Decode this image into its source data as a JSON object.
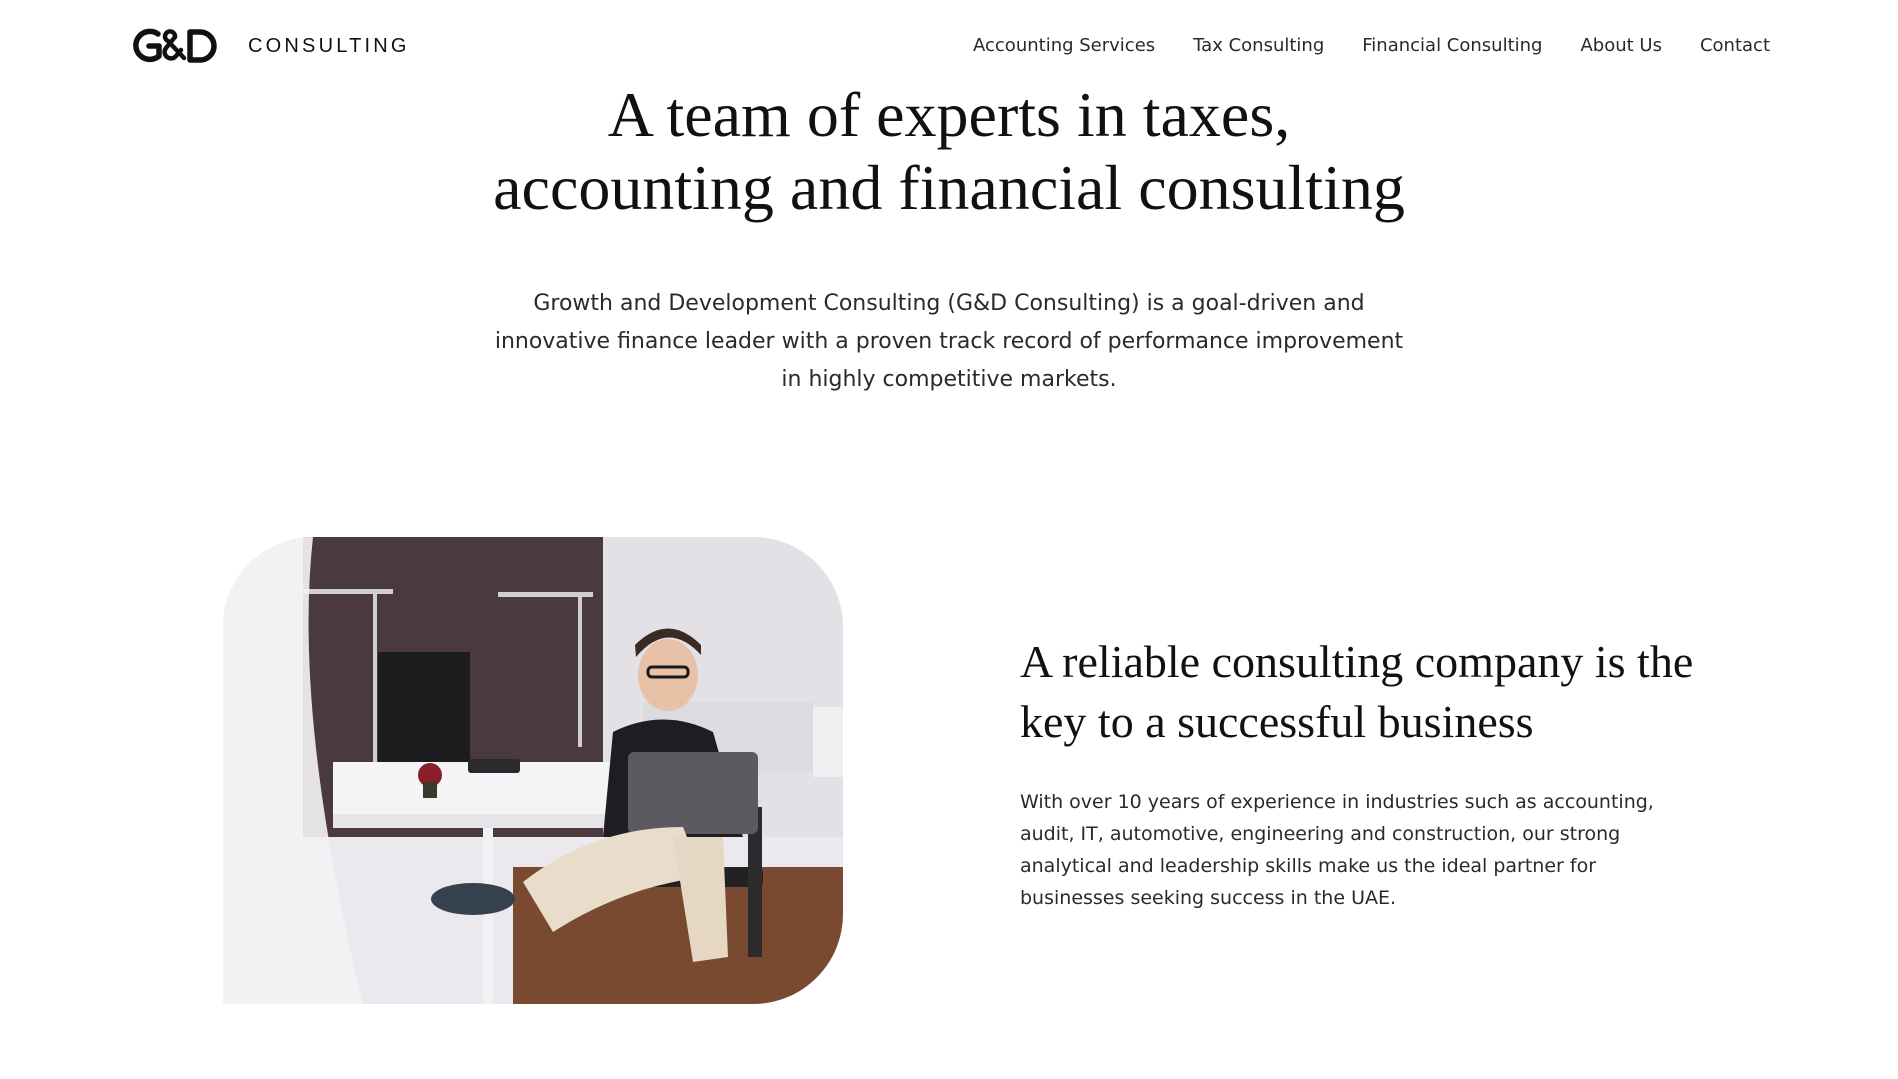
{
  "header": {
    "brand_wordmark": "CONSULTING",
    "logo_monogram": "G&D",
    "nav": [
      {
        "label": "Accounting Services"
      },
      {
        "label": "Tax Consulting"
      },
      {
        "label": "Financial Consulting"
      },
      {
        "label": "About Us"
      },
      {
        "label": "Contact"
      }
    ]
  },
  "hero": {
    "title_lines": [
      "A team of experts in taxes,",
      "accounting and financial consulting"
    ],
    "lead_lines": [
      "Growth and Development Consulting (G&D Consulting) is a goal-driven and",
      "innovative finance leader with a proven track record of performance improvement",
      "in highly competitive markets."
    ]
  },
  "feature": {
    "title_lines": [
      "A reliable consulting company is the",
      "key to a successful business"
    ],
    "text_lines": [
      "With over 10 years of experience in industries such as accounting,",
      "audit, IT, automotive, engineering and construction, our strong",
      "analytical and leadership skills make us the ideal partner for",
      "businesses seeking success in the UAE."
    ]
  },
  "colors": {
    "text": "#111111",
    "body_text": "#2a2a2a",
    "background": "#ffffff"
  }
}
